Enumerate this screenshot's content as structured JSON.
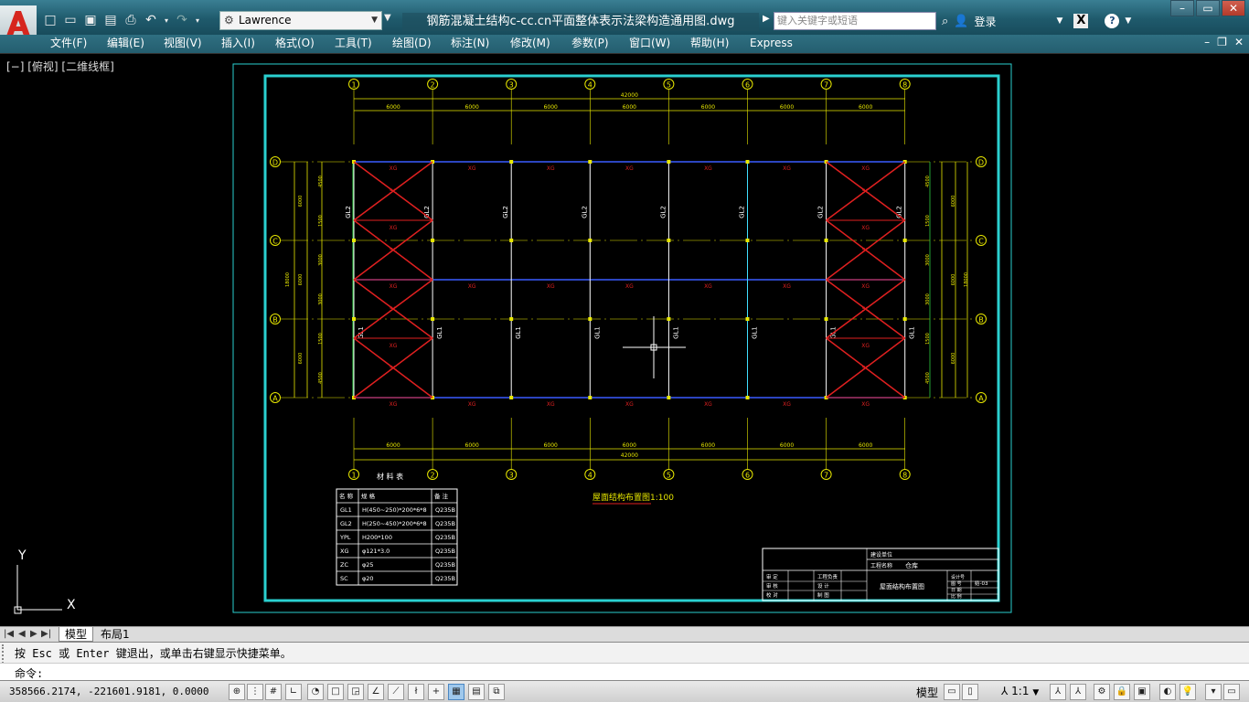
{
  "title_bar": {
    "workspace": "Lawrence",
    "document_title": "钢筋混凝土结构c-cc.cn平面整体表示法梁构造通用图.dwg",
    "search_placeholder": "键入关键字或短语",
    "login_label": "登录"
  },
  "quick_access_icons": [
    "new-icon",
    "open-icon",
    "save-icon",
    "save-as-icon",
    "print-icon",
    "undo-icon",
    "undo-dropdown-icon",
    "redo-icon",
    "redo-dropdown-icon"
  ],
  "menu": [
    "文件(F)",
    "编辑(E)",
    "视图(V)",
    "插入(I)",
    "格式(O)",
    "工具(T)",
    "绘图(D)",
    "标注(N)",
    "修改(M)",
    "参数(P)",
    "窗口(W)",
    "帮助(H)",
    "Express"
  ],
  "viewport_label": "[−] [俯视] [二维线框]",
  "drawing": {
    "axis_numbers": [
      "1",
      "2",
      "3",
      "4",
      "5",
      "6",
      "7",
      "8"
    ],
    "axis_letters_top_down": [
      "D",
      "C",
      "B",
      "A"
    ],
    "total_dim": "42000",
    "bay_dims": [
      "6000",
      "6000",
      "6000",
      "6000",
      "6000",
      "6000",
      "6000"
    ],
    "right_dims_outer": [
      "6000",
      "6000",
      "6000"
    ],
    "right_dims_inner": [
      "4500",
      "1500",
      "3000",
      "3000",
      "1500",
      "4500"
    ],
    "left_total": "18000",
    "beam_label_top_row": "GL2",
    "beam_label_bottom_row": "GL1",
    "xg_label": "XG",
    "sc_label": "SC",
    "plan_caption": "屋面结构布置图1:100",
    "material_table": {
      "title": "材 料 表",
      "headers": [
        "名 称",
        "规   格",
        "备 注"
      ],
      "rows": [
        [
          "GL1",
          "H(450~250)*200*6*8",
          "Q235B"
        ],
        [
          "GL2",
          "H(250~450)*200*6*8",
          "Q235B"
        ],
        [
          "YPL",
          "H200*100",
          "Q235B"
        ],
        [
          "XG",
          "φ121*3.0",
          "Q235B"
        ],
        [
          "ZC",
          "φ25",
          "Q235B"
        ],
        [
          "SC",
          "φ20",
          "Q235B"
        ]
      ]
    },
    "title_block": {
      "company_label": "建设单位",
      "project_label": "工程名称",
      "project_value": "仓库",
      "drawing_name": "屋面结构布置图",
      "left_labels": [
        "审 定",
        "审 核",
        "校 对"
      ],
      "mid_labels": [
        "工程负责",
        "设 计",
        "制 图"
      ],
      "right_labels": [
        "设计号",
        "图 号",
        "日 期",
        "比 例"
      ],
      "sheet_no": "结-03"
    }
  },
  "ucs": {
    "x": "X",
    "y": "Y"
  },
  "tabs": {
    "model": "模型",
    "layout1": "布局1"
  },
  "command_line": {
    "history": "按 Esc 或 Enter 键退出，或单击右键显示快捷菜单。",
    "prompt": "命令:"
  },
  "status_bar": {
    "coordinates": "358566.2174, -221601.9181, 0.0000",
    "model_label": "模型",
    "annotation_scale": "1:1"
  }
}
